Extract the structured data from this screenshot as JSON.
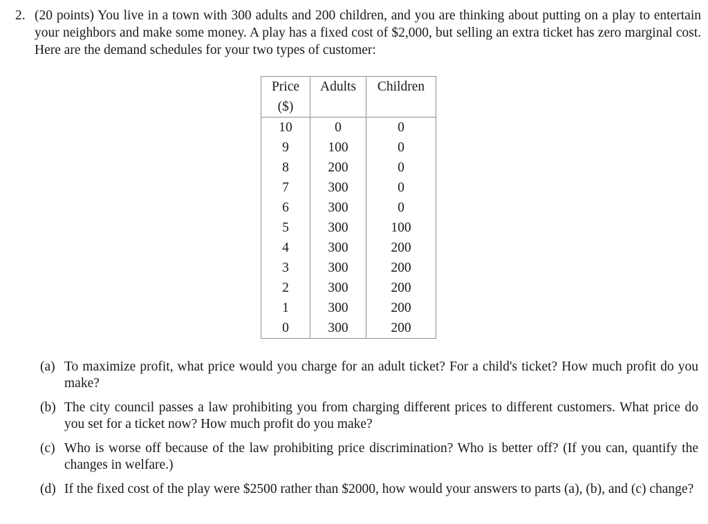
{
  "problem": {
    "number": "2.",
    "text": "(20 points) You live in a town with 300 adults and 200 children, and you are thinking about putting on a play to entertain your neighbors and make some money. A play has a fixed cost of $2,000, but selling an extra ticket has zero marginal cost. Here are the demand schedules for your two types of customer:"
  },
  "table": {
    "headers": {
      "price_line1": "Price",
      "price_line2": "($)",
      "adults": "Adults",
      "children": "Children"
    },
    "rows": [
      {
        "price": "10",
        "adults": "0",
        "children": "0"
      },
      {
        "price": "9",
        "adults": "100",
        "children": "0"
      },
      {
        "price": "8",
        "adults": "200",
        "children": "0"
      },
      {
        "price": "7",
        "adults": "300",
        "children": "0"
      },
      {
        "price": "6",
        "adults": "300",
        "children": "0"
      },
      {
        "price": "5",
        "adults": "300",
        "children": "100"
      },
      {
        "price": "4",
        "adults": "300",
        "children": "200"
      },
      {
        "price": "3",
        "adults": "300",
        "children": "200"
      },
      {
        "price": "2",
        "adults": "300",
        "children": "200"
      },
      {
        "price": "1",
        "adults": "300",
        "children": "200"
      },
      {
        "price": "0",
        "adults": "300",
        "children": "200"
      }
    ]
  },
  "parts": [
    {
      "label": "(a)",
      "text": "To maximize profit, what price would you charge for an adult ticket? For a child's ticket? How much profit do you make?"
    },
    {
      "label": "(b)",
      "text": "The city council passes a law prohibiting you from charging different prices to different customers. What price do you set for a ticket now? How much profit do you make?"
    },
    {
      "label": "(c)",
      "text": "Who is worse off because of the law prohibiting price discrimination? Who is better off? (If you can, quantify the changes in welfare.)"
    },
    {
      "label": "(d)",
      "text": "If the fixed cost of the play were $2500 rather than $2000, how would your answers to parts (a), (b), and (c) change?"
    }
  ],
  "colors": {
    "page_background": "#ffffff",
    "text": "#1a1a1a",
    "table_border": "#8c8c8c"
  }
}
